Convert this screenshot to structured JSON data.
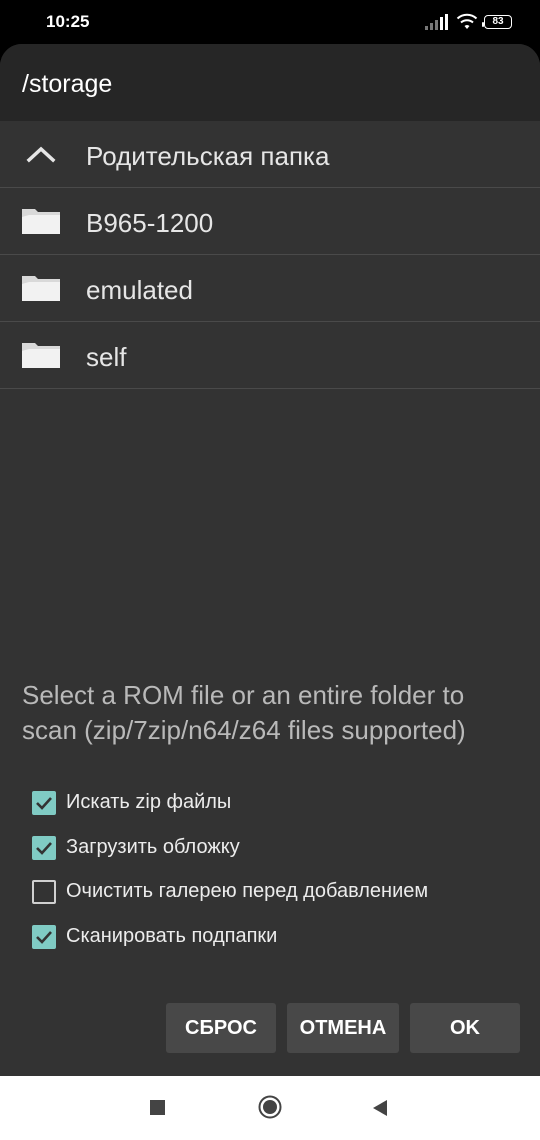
{
  "status_bar": {
    "time": "10:25",
    "battery": "83",
    "icons": [
      "signal-icon",
      "wifi-icon",
      "battery-icon"
    ]
  },
  "dialog": {
    "title": "/storage",
    "rows": [
      {
        "icon": "chevron-up-icon",
        "label": "Родительская папка"
      },
      {
        "icon": "folder-icon",
        "label": "B965-1200"
      },
      {
        "icon": "folder-icon",
        "label": "emulated"
      },
      {
        "icon": "folder-icon",
        "label": "self"
      }
    ],
    "description": "Select a ROM file or an entire folder to scan (zip/7zip/n64/z64 files supported)",
    "options": [
      {
        "label": "Искать zip файлы",
        "checked": true
      },
      {
        "label": "Загрузить обложку",
        "checked": true
      },
      {
        "label": "Очистить галерею перед добавлением",
        "checked": false
      },
      {
        "label": "Сканировать подпапки",
        "checked": true
      }
    ],
    "buttons": {
      "reset": "СБРОС",
      "cancel": "ОТМЕНА",
      "ok": "OK"
    }
  },
  "colors": {
    "dialog_bg": "#333333",
    "header_bg": "#262626",
    "checkbox_accent": "#80cbc4",
    "button_bg": "#484848"
  },
  "nav_bar": {
    "icons": [
      "recents-icon",
      "home-icon",
      "back-icon"
    ]
  }
}
